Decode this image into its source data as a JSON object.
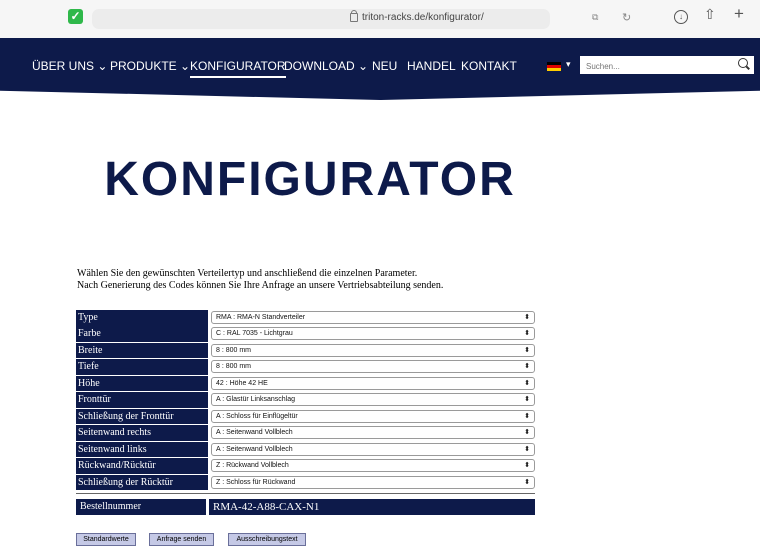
{
  "browser": {
    "url": "triton-racks.de/konfigurator/"
  },
  "nav": {
    "items": [
      {
        "label": "ÜBER UNS",
        "has_dropdown": true
      },
      {
        "label": "PRODUKTE",
        "has_dropdown": true
      },
      {
        "label": "KONFIGURATOR",
        "has_dropdown": false,
        "active": true
      },
      {
        "label": "DOWNLOAD",
        "has_dropdown": true
      },
      {
        "label": "NEU",
        "has_dropdown": false
      },
      {
        "label": "HANDEL",
        "has_dropdown": false
      },
      {
        "label": "KONTAKT",
        "has_dropdown": false
      }
    ],
    "language_flag": "de",
    "search_placeholder": "Suchen..."
  },
  "page": {
    "title": "KONFIGURATOR",
    "intro_line1": "Wählen Sie den gewünschten Verteilertyp und anschließend die einzelnen Parameter.",
    "intro_line2": "Nach Generierung des Codes können Sie Ihre Anfrage an unsere Vertriebsabteilung senden."
  },
  "config": [
    {
      "label": "Type",
      "value": "RMA : RMA-N Standverteiler"
    },
    {
      "label": "Farbe",
      "value": "C : RAL 7035 - Lichtgrau"
    },
    {
      "label": "Breite",
      "value": "8 : 800 mm"
    },
    {
      "label": "Tiefe",
      "value": "8 : 800 mm"
    },
    {
      "label": "Höhe",
      "value": "42 : Höhe 42 HE"
    },
    {
      "label": "Fronttür",
      "value": "A : Glastür Linksanschlag"
    },
    {
      "label": "Schließung der Fronttür",
      "value": "A : Schloss für Einflügeltür"
    },
    {
      "label": "Seitenwand rechts",
      "value": "A : Seitenwand Vollblech"
    },
    {
      "label": "Seitenwand links",
      "value": "A : Seitenwand Vollblech"
    },
    {
      "label": "Rückwand/Rücktür",
      "value": "Z : Rückwand Vollblech"
    },
    {
      "label": "Schließung der Rücktür",
      "value": "Z : Schloss für Rückwand"
    }
  ],
  "order": {
    "label": "Bestellnummer",
    "value": "RMA-42-A88-CAX-N1"
  },
  "buttons": {
    "defaults": "Standardwerte",
    "send": "Anfrage senden",
    "tender": "Ausschreibungstext"
  },
  "colors": {
    "brand_navy": "#0d1a4a",
    "button_bg": "#c5c9e6"
  }
}
